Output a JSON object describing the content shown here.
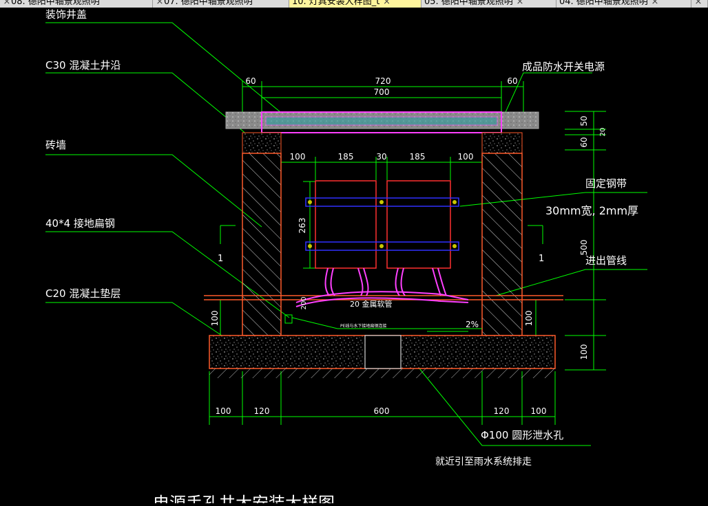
{
  "tabs": [
    {
      "label": "08. 德阳中轴景观照明",
      "active": false
    },
    {
      "label": "07. 德阳中轴景观照明",
      "active": false
    },
    {
      "label": "10. 灯具安装大样图_t",
      "active": true
    },
    {
      "label": "05. 德阳中轴景观照明",
      "active": false
    },
    {
      "label": "04. 德阳中轴景观照明",
      "active": false
    }
  ],
  "labels": {
    "cover": "装饰井盖",
    "c30": "C30 混凝土井沿",
    "brick": "砖墙",
    "steel": "40*4 接地扁钢",
    "c20": "C20 混凝土垫层",
    "switch": "成品防水开关电源",
    "strap": "固定钢带",
    "strap_spec": "30mm宽,   2mm厚",
    "pipe_in": "进出管线",
    "conduit": "20 金属软管",
    "pe": "PE线与水下接地扁钢连接",
    "slope": "2%",
    "drain": "Φ100  圆形泄水孔",
    "drain_note": "就近引至雨水系统排走",
    "section_mark_left": "1",
    "section_mark_right": "1",
    "title": "电源手孔井大安装大样图"
  },
  "dims": {
    "top_total": "720",
    "top_inner": "700",
    "top_left": "60",
    "top_right": "60",
    "row_100a": "100",
    "row_185a": "185",
    "row_30": "30",
    "row_185b": "185",
    "row_100b": "100",
    "box_h": "263",
    "conduit_h": "200",
    "left_100": "100",
    "right_100": "100",
    "right_50": "50",
    "right_20": "20",
    "right_60": "60",
    "right_500": "500",
    "base_100": "100",
    "bot_100a": "100",
    "bot_120a": "120",
    "bot_600": "600",
    "bot_120b": "120",
    "bot_100b": "100"
  },
  "colors": {
    "leader": "#00ff00",
    "dim": "#00ff00",
    "wall": "#ff5a2a",
    "box": "#ff3030",
    "strap": "#3030ff",
    "conduit": "#ff40ff",
    "text": "#ffffff"
  }
}
